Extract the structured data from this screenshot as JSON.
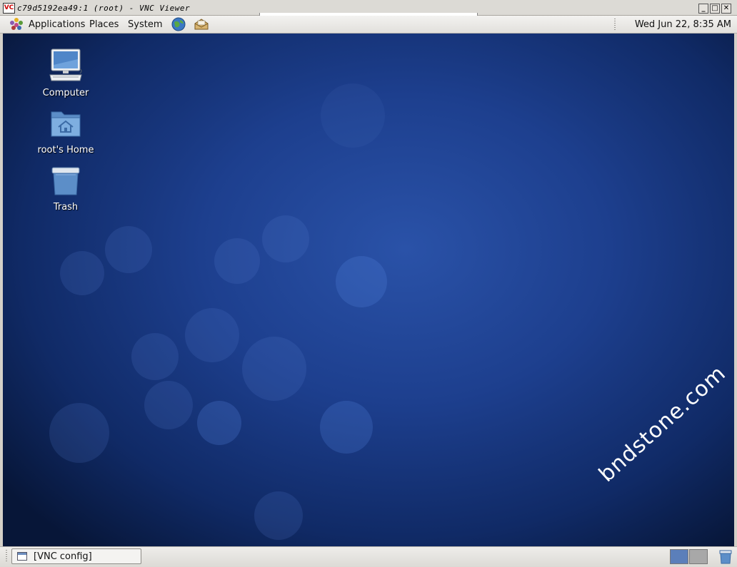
{
  "window": {
    "icon": "VC",
    "title": "c79d5192ea49:1 (root) - VNC Viewer",
    "buttons": {
      "minimize": "_",
      "maximize": "□",
      "close": "✕"
    }
  },
  "top_panel": {
    "menus": [
      "Applications",
      "Places",
      "System"
    ],
    "launchers": [
      "web-browser-icon",
      "mail-client-icon"
    ],
    "clock": "Wed Jun 22,  8:35 AM"
  },
  "desktop": {
    "icons": [
      {
        "label": "Computer",
        "icon": "computer-icon"
      },
      {
        "label": "root's Home",
        "icon": "home-folder-icon"
      },
      {
        "label": "Trash",
        "icon": "trash-icon"
      }
    ],
    "watermark": "bndstone.com"
  },
  "bottom_panel": {
    "task": "[VNC config]",
    "workspaces": 2,
    "active_workspace": 1
  },
  "colors": {
    "desktop_blue": "#1d3f8e",
    "workspace_active": "#5b7fba",
    "workspace_inactive": "#a8a8a8"
  }
}
